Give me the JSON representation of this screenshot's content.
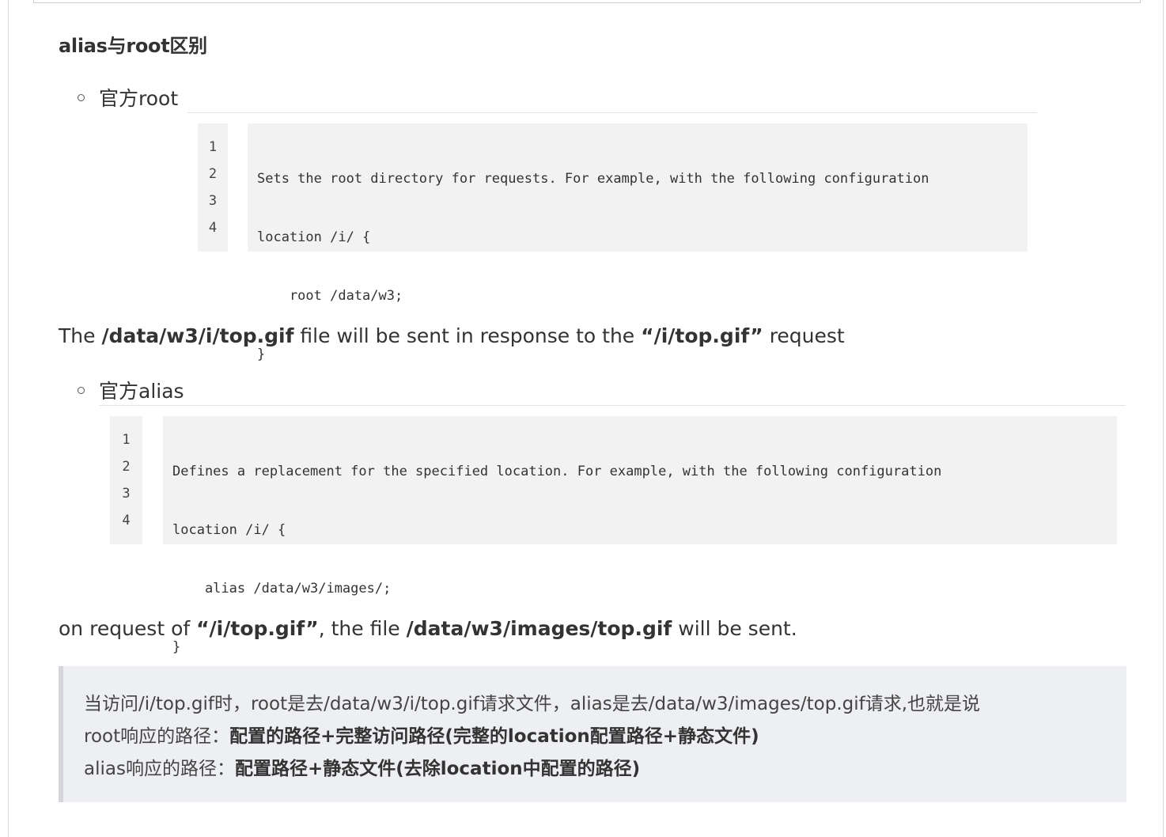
{
  "heading": "alias与root区别",
  "root_item": {
    "label": "官方root"
  },
  "root_code": {
    "line_numbers": [
      "1",
      "2",
      "3",
      "4"
    ],
    "lines": [
      "Sets the root directory for requests. For example, with the following configuration",
      "location /i/ {",
      "    root /data/w3;",
      "}"
    ]
  },
  "root_para": {
    "t1": "The ",
    "b1": "/data/w3/i/top.gif",
    "t2": " file will be sent in response to the ",
    "b2": "“/i/top.gif”",
    "t3": " request"
  },
  "alias_item": {
    "label": "官方alias"
  },
  "alias_code": {
    "line_numbers": [
      "1",
      "2",
      "3",
      "4"
    ],
    "lines": [
      "Defines a replacement for the specified location. For example, with the following configuration",
      "location /i/ {",
      "    alias /data/w3/images/;",
      "}"
    ]
  },
  "alias_para": {
    "t1": "on request of ",
    "b1": "“/i/top.gif”",
    "t2": ", the file ",
    "b2": "/data/w3/images/top.gif",
    "t3": " will be sent."
  },
  "quote": {
    "line1": "当访问/i/top.gif时，root是去/data/w3/i/top.gif请求文件，alias是去/data/w3/images/top.gif请求,也就是说",
    "line2_prefix": "root响应的路径：",
    "line2_bold": "配置的路径+完整访问路径(完整的location配置路径+静态文件)",
    "line3_prefix": "alias响应的路径：",
    "line3_bold": "配置路径+静态文件(去除location中配置的路径)"
  }
}
